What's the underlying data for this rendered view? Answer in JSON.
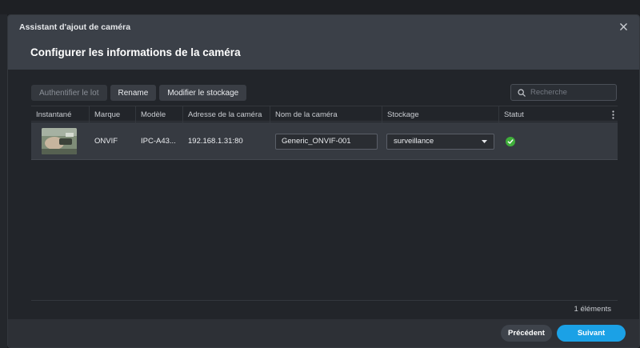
{
  "window": {
    "title": "Assistant d'ajout de caméra",
    "close_icon": "close-icon"
  },
  "page": {
    "title": "Configurer les informations de la caméra"
  },
  "toolbar": {
    "auth_label": "Authentifier le lot",
    "rename_label": "Rename",
    "storage_label": "Modifier le stockage"
  },
  "search": {
    "placeholder": "Recherche",
    "value": ""
  },
  "table": {
    "columns": [
      "Instantané",
      "Marque",
      "Modèle",
      "Adresse de la caméra",
      "Nom de la caméra",
      "Stockage",
      "Statut"
    ],
    "rows": [
      {
        "brand": "ONVIF",
        "model": "IPC-A43...",
        "address": "192.168.1.31:80",
        "name": "Generic_ONVIF-001",
        "storage": "surveillance",
        "status_icon": "check-circle-icon"
      }
    ]
  },
  "footer": {
    "count": "1 éléments",
    "prev_label": "Précédent",
    "next_label": "Suivant"
  },
  "colors": {
    "accent": "#1ba1e6",
    "status_ok": "#3fae3a",
    "header_bg": "#3b4048"
  }
}
